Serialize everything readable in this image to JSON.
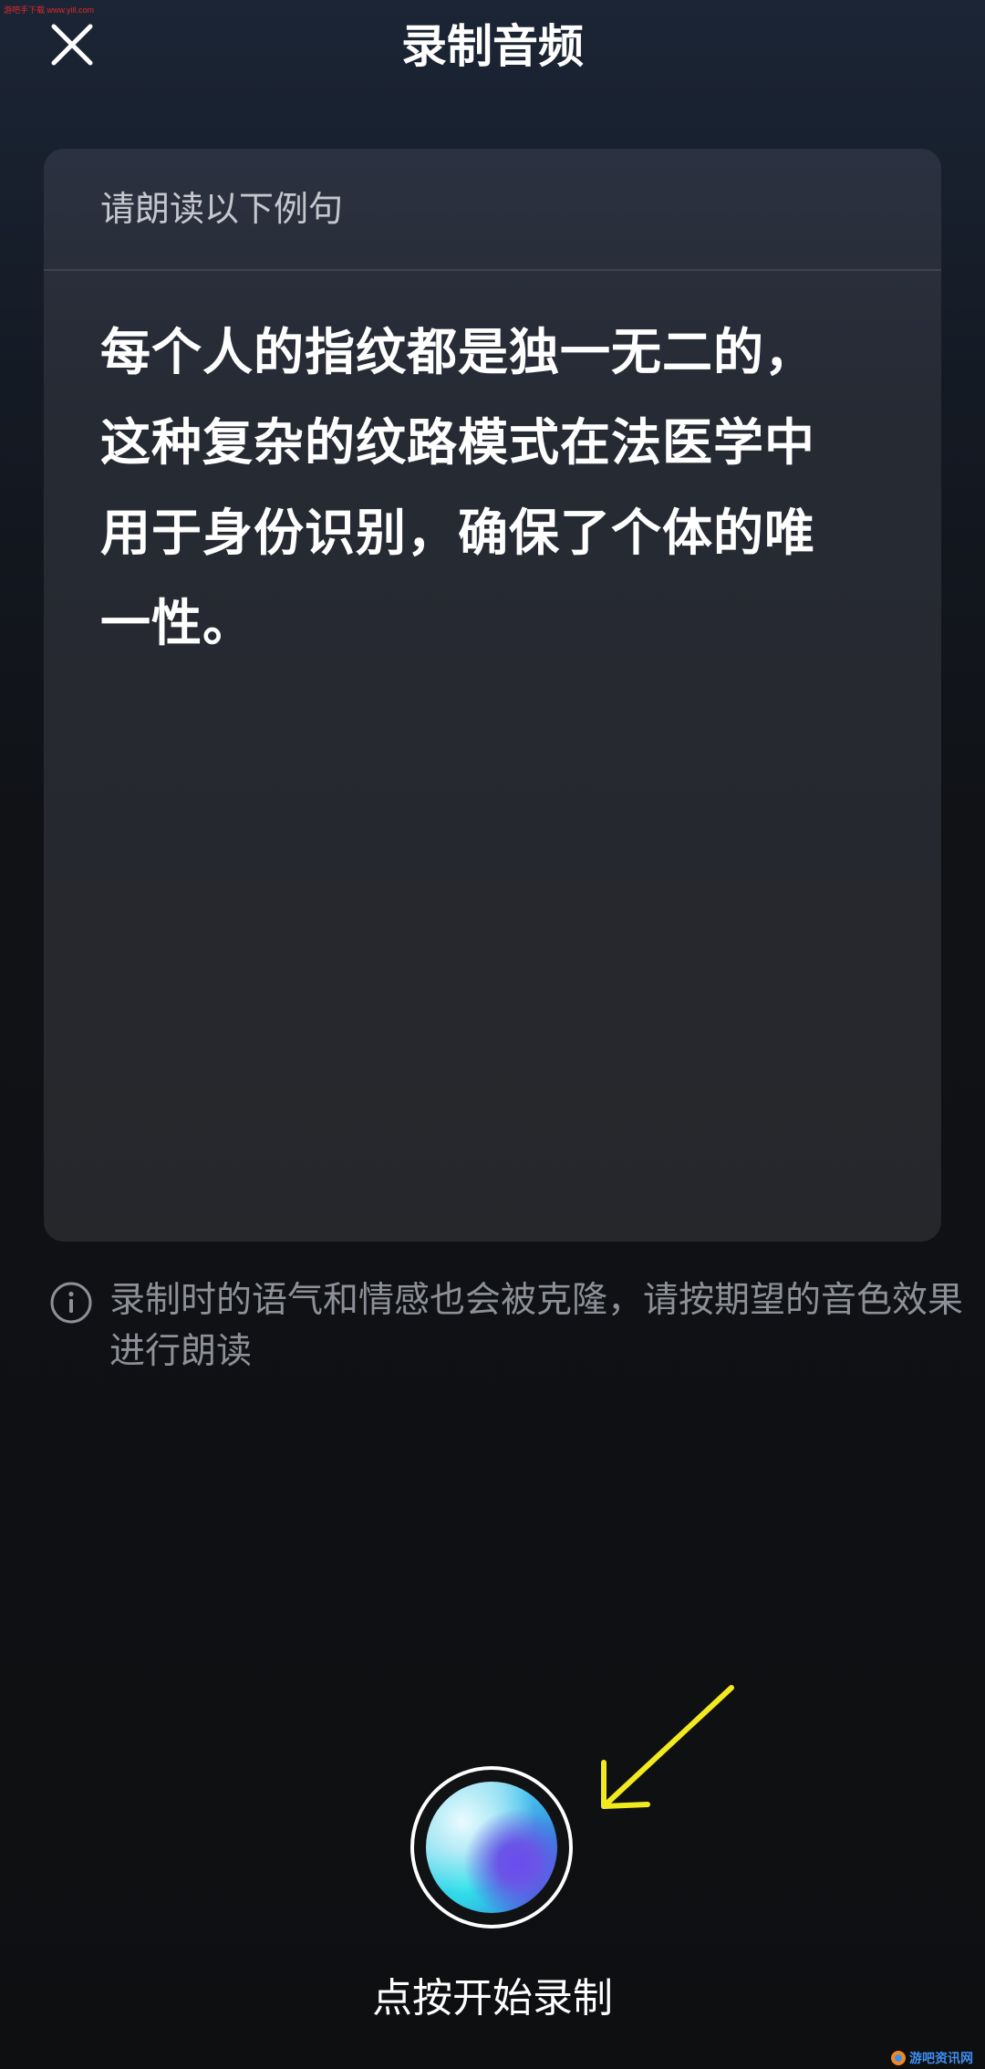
{
  "watermark": {
    "top": "游吧手下载 www.yill.com",
    "bottom": "游吧资讯网"
  },
  "header": {
    "close_icon": "close-icon",
    "title": "录制音频"
  },
  "card": {
    "label": "请朗读以下例句",
    "sentence_lines": [
      "每个人的指纹都是独一无二的，",
      "这种复杂的纹路模式在法医学中",
      "用于身份识别，确保了个体的唯",
      "一性。"
    ]
  },
  "tip": {
    "icon": "info-icon",
    "text": "录制时的语气和情感也会被克隆，请按期望的音色效果进行朗读"
  },
  "record": {
    "icon": "record-orb",
    "label": "点按开始录制"
  },
  "annotation": {
    "icon": "arrow-icon",
    "color": "#f2ea1e"
  },
  "colors": {
    "background_top": "#1b2535",
    "background_bottom": "#0e0f11",
    "card": "#26272b",
    "muted_text": "#8d9097"
  }
}
